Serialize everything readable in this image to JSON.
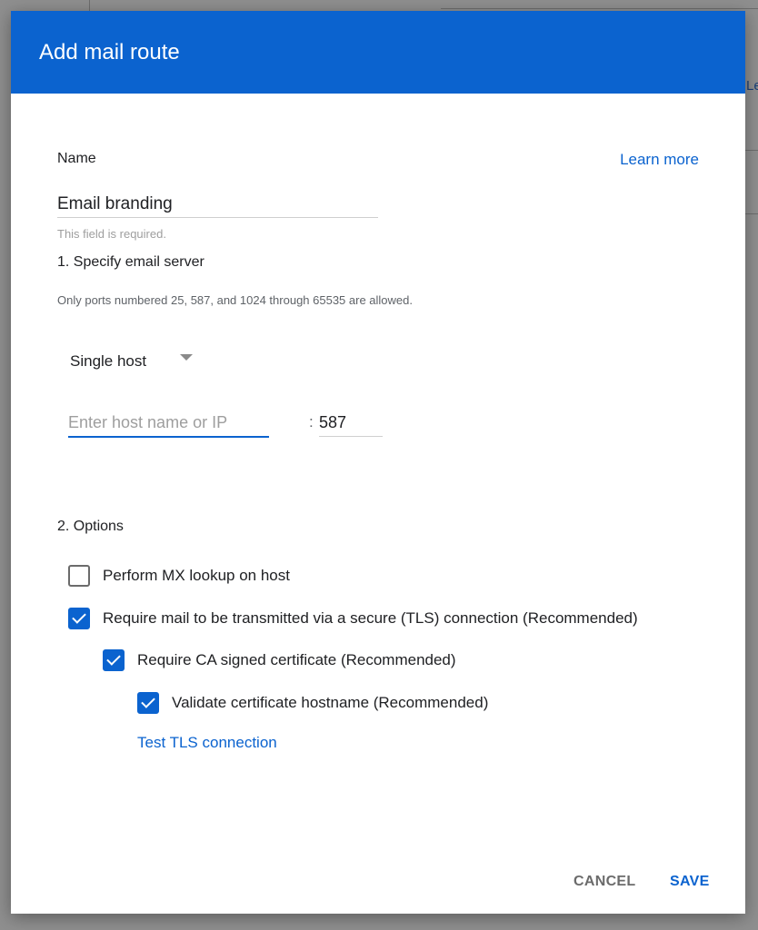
{
  "background": {
    "peek_text": "Le"
  },
  "dialog": {
    "title": "Add mail route",
    "name": {
      "label": "Name",
      "learn_more": "Learn more",
      "value": "Email branding",
      "helper": "This field is required."
    },
    "server": {
      "heading": "1. Specify email server",
      "note": "Only ports numbered 25, 587, and 1024 through 65535 are allowed.",
      "host_mode": "Single host",
      "host_placeholder": "Enter host name or IP",
      "colon": ":",
      "port": "587"
    },
    "options": {
      "heading": "2. Options",
      "mx_lookup": {
        "label": "Perform MX lookup on host",
        "checked": false
      },
      "require_tls": {
        "label": "Require mail to be transmitted via a secure (TLS) connection (Recommended)",
        "checked": true
      },
      "require_ca": {
        "label": "Require CA signed certificate (Recommended)",
        "checked": true
      },
      "validate_hostname": {
        "label": "Validate certificate hostname (Recommended)",
        "checked": true
      },
      "test_tls": "Test TLS connection"
    },
    "actions": {
      "cancel": "CANCEL",
      "save": "SAVE"
    }
  },
  "colors": {
    "primary": "#0b63cf",
    "text": "#202124",
    "muted": "#9e9e9e"
  }
}
